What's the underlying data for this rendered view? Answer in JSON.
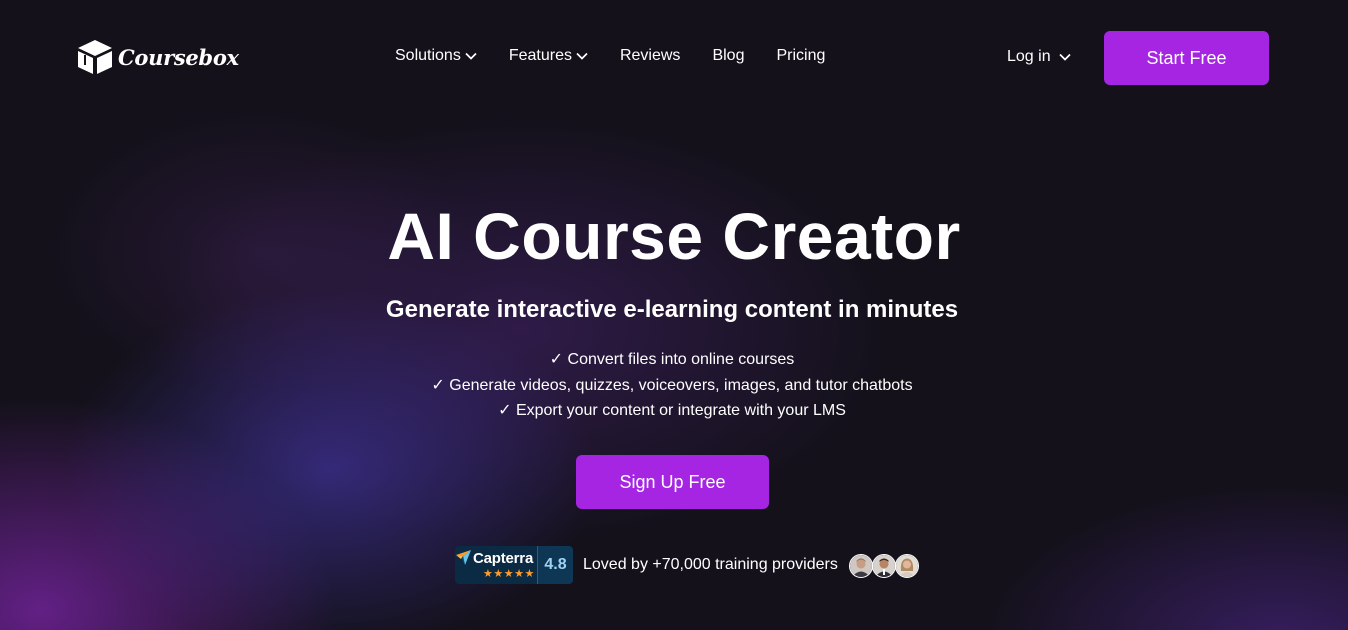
{
  "header": {
    "brand": "Coursebox",
    "brand_icon": "box-icon",
    "nav": [
      {
        "label": "Solutions",
        "has_dropdown": true
      },
      {
        "label": "Features",
        "has_dropdown": true
      },
      {
        "label": "Reviews",
        "has_dropdown": false
      },
      {
        "label": "Blog",
        "has_dropdown": false
      },
      {
        "label": "Pricing",
        "has_dropdown": false
      }
    ],
    "login_label": "Log in",
    "start_label": "Start Free"
  },
  "hero": {
    "title": "AI Course Creator",
    "subtitle": "Generate interactive e-learning content in minutes",
    "features": [
      "✓ Convert files into online courses",
      "✓ Generate videos, quizzes, voiceovers, images, and tutor chatbots",
      "✓ Export your content or integrate with your LMS"
    ],
    "cta_label": "Sign Up Free"
  },
  "rating": {
    "platform": "Capterra",
    "stars": "★★★★★",
    "score": "4.8",
    "loved_text": "Loved by +70,000 training providers",
    "avatars": [
      "reviewer-avatar-1",
      "reviewer-avatar-2",
      "reviewer-avatar-3"
    ]
  },
  "colors": {
    "accent": "#a525e2",
    "background": "#14111b",
    "capterra_bg": "#0b2a44",
    "star": "#ff9d28"
  }
}
